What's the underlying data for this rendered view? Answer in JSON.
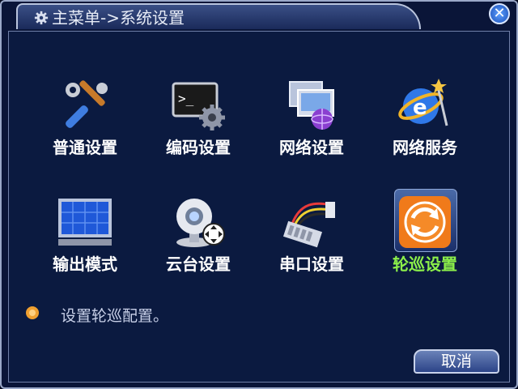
{
  "window": {
    "title": "主菜单->系统设置",
    "close_icon": "close-icon"
  },
  "menu_items": [
    {
      "label": "普通设置",
      "icon": "tools-icon"
    },
    {
      "label": "编码设置",
      "icon": "terminal-gear-icon"
    },
    {
      "label": "网络设置",
      "icon": "network-monitor-icon"
    },
    {
      "label": "网络服务",
      "icon": "internet-globe-icon"
    },
    {
      "label": "输出模式",
      "icon": "monitor-grid-icon"
    },
    {
      "label": "云台设置",
      "icon": "ptz-camera-icon"
    },
    {
      "label": "串口设置",
      "icon": "serial-cable-icon"
    },
    {
      "label": "轮巡设置",
      "icon": "tour-refresh-icon",
      "selected": true
    }
  ],
  "description": "设置轮巡配置。",
  "buttons": {
    "cancel": "取消"
  },
  "colors": {
    "background": "#0b1a40",
    "selected_label": "#8cf04a",
    "label": "#ffffff"
  }
}
